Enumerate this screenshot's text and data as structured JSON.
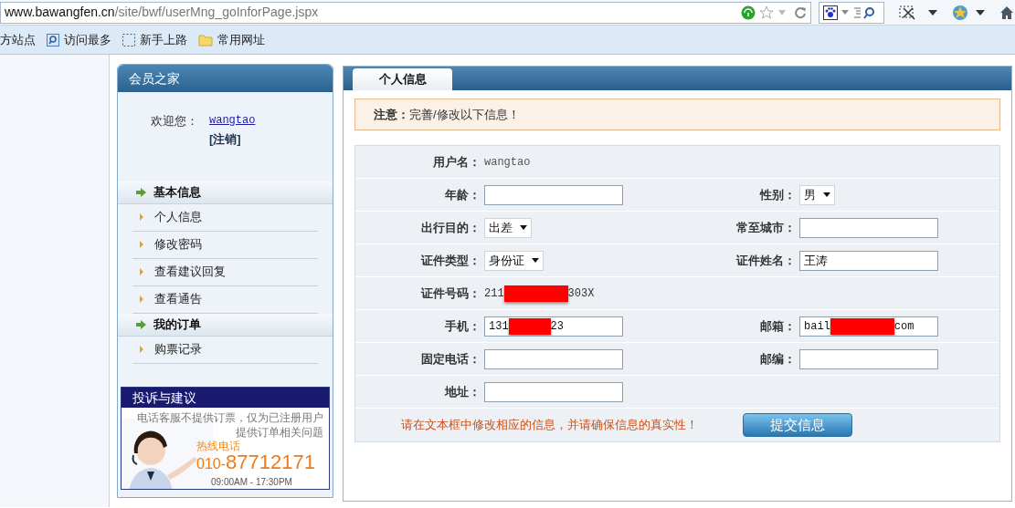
{
  "browser": {
    "url_host": "www.bawangfen.cn",
    "url_path": "/site/bwf/userMng_goInforPage.jspx",
    "bookmarks": [
      {
        "label": "方站点",
        "kind": "none"
      },
      {
        "label": "访问最多",
        "kind": "page"
      },
      {
        "label": "新手上路",
        "kind": "dashed"
      },
      {
        "label": "常用网址",
        "kind": "folder"
      }
    ]
  },
  "sidebar": {
    "title": "会员之家",
    "welcome": "欢迎您：",
    "username": "wangtao",
    "logout": "[注销]",
    "sections": [
      {
        "title": "基本信息",
        "items": [
          "个人信息",
          "修改密码",
          "查看建议回复",
          "查看通告"
        ]
      },
      {
        "title": "我的订单",
        "items": [
          "购票记录"
        ]
      }
    ],
    "banner": {
      "title": "投诉与建议",
      "lines": [
        "电话客服不提供订票，仅为已注册用户",
        "提供订单相关问题"
      ],
      "hotline_label": "热线电话",
      "phone_prefix": "010-",
      "phone": "87712171",
      "hours": "09:00AM - 17:30PM"
    }
  },
  "tabs": [
    {
      "label": "个人信息",
      "selected": true
    }
  ],
  "notice": {
    "label": "注意：",
    "text": "完善/修改以下信息！"
  },
  "form": {
    "rows": [
      [
        {
          "label": "用户名：",
          "kind": "text",
          "value": "wangtao"
        }
      ],
      [
        {
          "label": "年龄：",
          "kind": "input"
        },
        {
          "label": "性别：",
          "kind": "select",
          "value": "男"
        }
      ],
      [
        {
          "label": "出行目的：",
          "kind": "select",
          "value": "出差"
        },
        {
          "label": "常至城市：",
          "kind": "input"
        }
      ],
      [
        {
          "label": "证件类型：",
          "kind": "select",
          "value": "身份证"
        },
        {
          "label": "证件姓名：",
          "kind": "input",
          "value": "王涛"
        }
      ],
      [
        {
          "label": "证件号码：",
          "kind": "redacted_text",
          "before": "211",
          "after": "303X"
        }
      ],
      [
        {
          "label": "手机：",
          "kind": "redacted_input",
          "before": "131",
          "after": "23"
        },
        {
          "label": "邮箱：",
          "kind": "redacted_input",
          "before": "bail",
          "after": "com"
        }
      ],
      [
        {
          "label": "固定电话：",
          "kind": "input"
        },
        {
          "label": "邮编：",
          "kind": "input"
        }
      ],
      [
        {
          "label": "地址：",
          "kind": "input"
        }
      ]
    ],
    "hint": "请在文本框中修改相应的信息，并请确保信息的真实性！",
    "submit": "提交信息"
  }
}
